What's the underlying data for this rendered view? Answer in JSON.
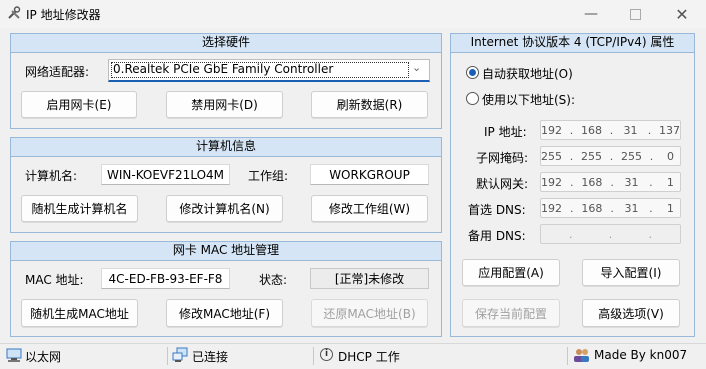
{
  "window": {
    "title": "IP 地址修改器",
    "minimize_icon": "minimize-icon",
    "maximize_icon": "maximize-icon",
    "close_icon": "close-icon"
  },
  "hardware": {
    "header": "选择硬件",
    "adapter_label": "网络适配器:",
    "adapter_value": "0.Realtek PCIe GbE Family Controller",
    "enable_button": "启用网卡(E)",
    "disable_button": "禁用网卡(D)",
    "refresh_button": "刷新数据(R)"
  },
  "computer": {
    "header": "计算机信息",
    "name_label": "计算机名:",
    "name_value": "WIN-KOEVF21LO4M",
    "workgroup_label": "工作组:",
    "workgroup_value": "WORKGROUP",
    "random_name_button": "随机生成计算机名",
    "change_name_button": "修改计算机名(N)",
    "change_workgroup_button": "修改工作组(W)"
  },
  "mac": {
    "header": "网卡 MAC 地址管理",
    "mac_label": "MAC 地址:",
    "mac_value": "4C-ED-FB-93-EF-F8",
    "status_label": "状态:",
    "status_value": "[正常]未修改",
    "random_mac_button": "随机生成MAC地址",
    "change_mac_button": "修改MAC地址(F)",
    "restore_mac_button": "还原MAC地址(B)"
  },
  "ipv4": {
    "header": "Internet 协议版本 4 (TCP/IPv4) 属性",
    "auto_radio": "自动获取地址(O)",
    "manual_radio": "使用以下地址(S):",
    "auto_selected": true,
    "ip_label": "IP 地址:",
    "ip": [
      "192",
      "168",
      "31",
      "137"
    ],
    "mask_label": "子网掩码:",
    "mask": [
      "255",
      "255",
      "255",
      "0"
    ],
    "gateway_label": "默认网关:",
    "gateway": [
      "192",
      "168",
      "31",
      "1"
    ],
    "dns1_label": "首选 DNS:",
    "dns1": [
      "192",
      "168",
      "31",
      "1"
    ],
    "dns2_label": "备用 DNS:",
    "dns2": [
      ".",
      ".",
      "."
    ],
    "apply_button": "应用配置(A)",
    "import_button": "导入配置(I)",
    "save_button": "保存当前配置",
    "advanced_button": "高级选项(V)"
  },
  "statusbar": {
    "network": "以太网",
    "connection": "已连接",
    "dhcp": "DHCP 工作",
    "author": "Made By kn007"
  }
}
